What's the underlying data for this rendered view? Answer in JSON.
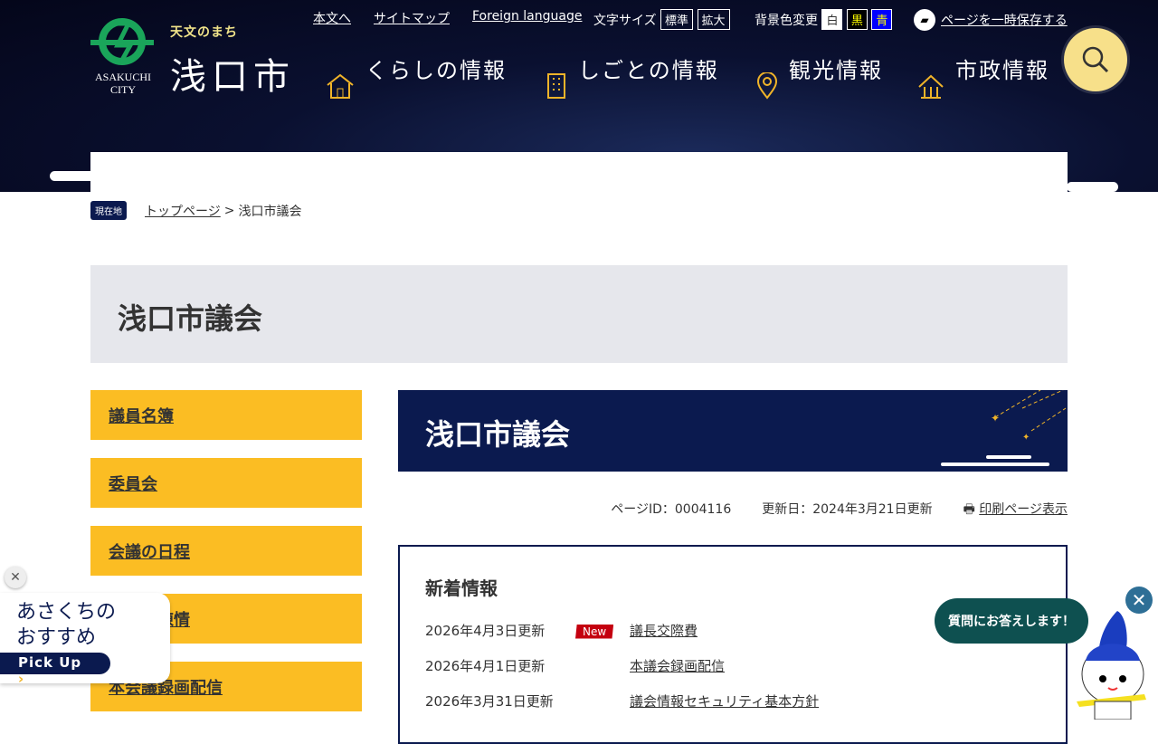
{
  "header": {
    "logo_city_en": "ASAKUCHI CITY",
    "logo_tagline": "天文のまち",
    "logo_name": "浅口市",
    "util": {
      "skip": "本文へ",
      "sitemap": "サイトマップ",
      "foreign": "Foreign language",
      "font_size_label": "文字サイズ",
      "font_standard": "標準",
      "font_large": "拡大",
      "bg_label": "背景色変更",
      "bg_white": "白",
      "bg_black": "黒",
      "bg_blue": "青",
      "save": "ページを一時保存する"
    },
    "nav": [
      {
        "label": "くらしの情報",
        "icon": "house-icon"
      },
      {
        "label": "しごとの情報",
        "icon": "building-icon"
      },
      {
        "label": "観光情報",
        "icon": "map-pin-icon"
      },
      {
        "label": "市政情報",
        "icon": "city-hall-icon"
      }
    ]
  },
  "breadcrumb": {
    "here": "現在地",
    "top": "トップページ",
    "sep": ">",
    "current": "浅口市議会"
  },
  "page_title": "浅口市議会",
  "sidebar": [
    "議員名簿",
    "委員会",
    "会議の日程",
    "請願・陳情",
    "本会議録画配信"
  ],
  "main": {
    "heading": "浅口市議会",
    "page_id": "ページID：0004116",
    "updated": "更新日：2024年3月21日更新",
    "print": "印刷ページ表示"
  },
  "news": {
    "title": "新着情報",
    "new_badge": "New",
    "items": [
      {
        "date": "2026年4月3日更新",
        "title": "議長交際費",
        "is_new": true
      },
      {
        "date": "2026年4月1日更新",
        "title": "本議会録画配信",
        "is_new": false
      },
      {
        "date": "2026年3月31日更新",
        "title": "議会情報セキュリティ基本方針",
        "is_new": false
      }
    ]
  },
  "pickup": {
    "line1": "あさくちの",
    "line2": "おすすめ",
    "button": "Pick Up"
  },
  "chatbot": {
    "bubble": "質問にお答えします！"
  },
  "colors": {
    "navy": "#0b1a4f",
    "yellow": "#fbbd23",
    "badge": "#c4000f",
    "chat": "#0e5050"
  }
}
